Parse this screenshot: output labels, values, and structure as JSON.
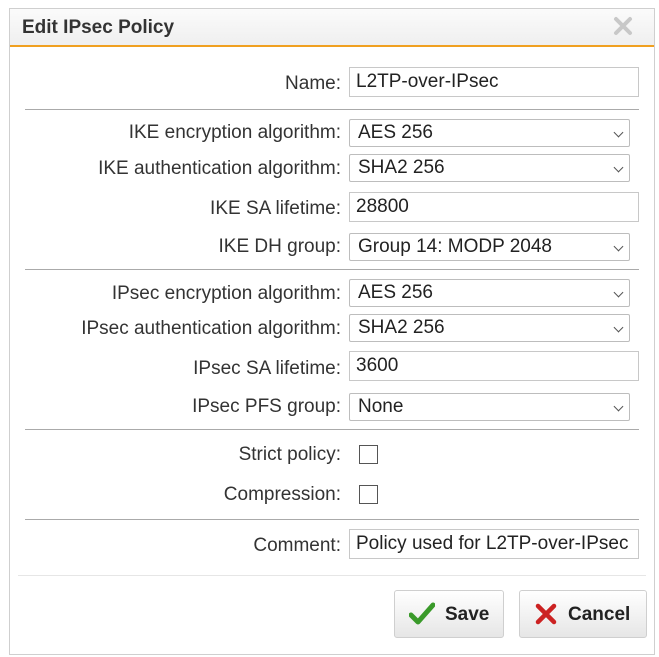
{
  "dialog": {
    "title": "Edit IPsec Policy",
    "close_icon": "close-icon"
  },
  "fields": {
    "name": {
      "label": "Name:",
      "value": "L2TP-over-IPsec"
    },
    "ike_encryption": {
      "label": "IKE encryption algorithm:",
      "value": "AES 256"
    },
    "ike_authentication": {
      "label": "IKE authentication algorithm:",
      "value": "SHA2 256"
    },
    "ike_sa_lifetime": {
      "label": "IKE SA lifetime:",
      "value": "28800"
    },
    "ike_dh_group": {
      "label": "IKE DH group:",
      "value": "Group 14: MODP 2048"
    },
    "ipsec_encryption": {
      "label": "IPsec encryption algorithm:",
      "value": "AES 256"
    },
    "ipsec_authentication": {
      "label": "IPsec authentication algorithm:",
      "value": "SHA2 256"
    },
    "ipsec_sa_lifetime": {
      "label": "IPsec SA lifetime:",
      "value": "3600"
    },
    "ipsec_pfs_group": {
      "label": "IPsec PFS group:",
      "value": "None"
    },
    "strict_policy": {
      "label": "Strict policy:",
      "checked": false
    },
    "compression": {
      "label": "Compression:",
      "checked": false
    },
    "comment": {
      "label": "Comment:",
      "value": "Policy used for L2TP-over-IPsec"
    }
  },
  "buttons": {
    "save": {
      "label": "Save",
      "icon": "checkmark-icon",
      "color": "#3a9a2a"
    },
    "cancel": {
      "label": "Cancel",
      "icon": "x-icon",
      "color": "#cc2222"
    }
  },
  "colors": {
    "accent": "#f0a020"
  }
}
